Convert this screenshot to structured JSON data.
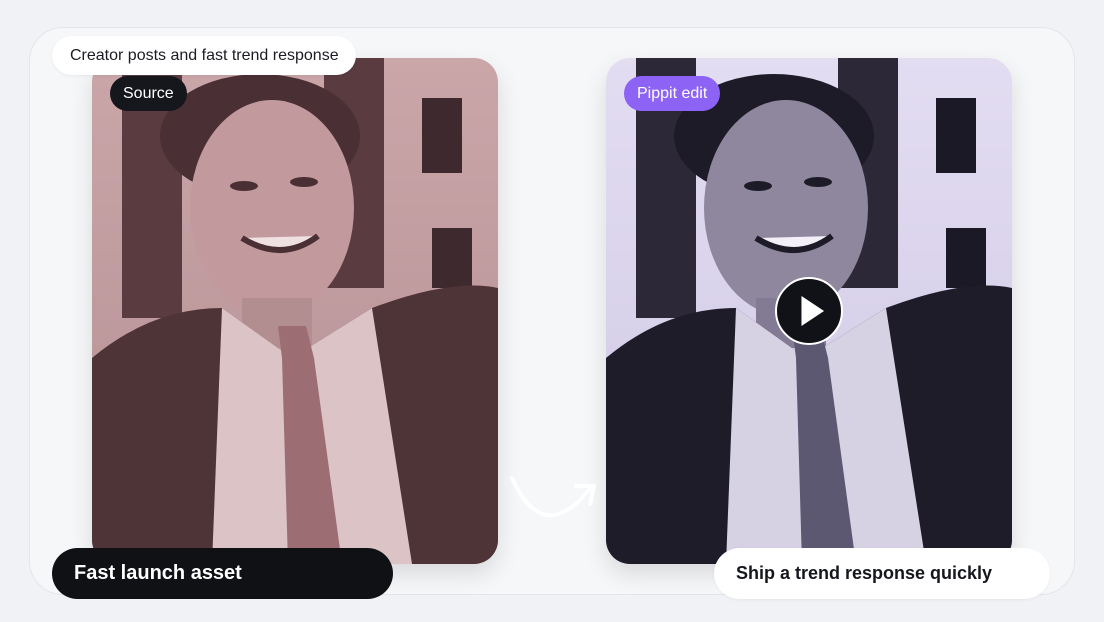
{
  "header": {
    "label": "Creator posts and fast trend response"
  },
  "source_card": {
    "badge": "Source",
    "tint": "#c9a3a7"
  },
  "edit_card": {
    "badge": "Pippit edit",
    "tint": "#ded7ef",
    "badge_color": "#8d63f5"
  },
  "footer": {
    "left_label": "Fast launch asset",
    "right_label": "Ship a trend response quickly"
  },
  "icons": {
    "play": "play-icon",
    "arrow": "curved-arrow-icon"
  }
}
